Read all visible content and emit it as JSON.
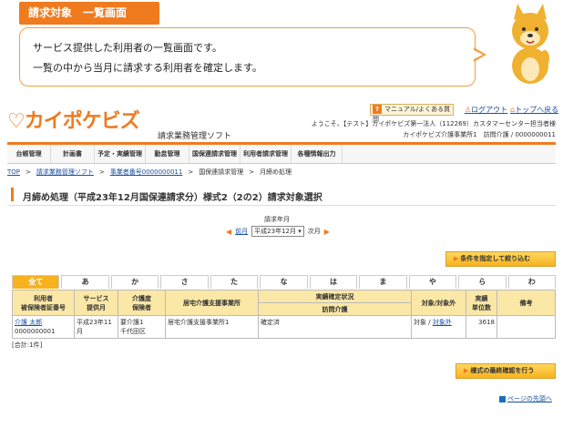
{
  "tutorial": {
    "title": "請求対象　一覧画面",
    "line1": "サービス提供した利用者の一覧画面です。",
    "line2": "一覧の中から当月に請求する利用者を確定します。"
  },
  "header": {
    "logo": "カイポケビズ",
    "subtitle": "請求業務管理ソフト",
    "help": "マニュアル/よくある質問",
    "logout": "ログアウト",
    "top": "トップへ戻る",
    "welcome1": "ようこそ、【テスト】カイポケビズ第一法人（112269）カスタマーセンター担当者様",
    "welcome2": "カイポケビズ介護事業所1　訪問介護 / 0000000011"
  },
  "menu": [
    "台帳管理",
    "計画書",
    "予定・実績管理",
    "勤怠管理",
    "国保連請求管理",
    "利用者請求管理",
    "各種情報出力"
  ],
  "breadcrumb": {
    "top": "TOP",
    "soft": "請求業務管理ソフト",
    "office": "事業者番号0000000011",
    "kokuho": "国保連請求管理",
    "current": "月締め処理"
  },
  "page_title": "月締め処理（平成23年12月国保連請求分）様式2（2の2）請求対象選択",
  "period": {
    "label": "請求年月",
    "prev": "前月",
    "selected": "平成23年12月",
    "next": "次月"
  },
  "buttons": {
    "filter": "条件を指定して絞り込む",
    "confirm": "様式の最終確認を行う"
  },
  "tabs": [
    "全て",
    "あ",
    "か",
    "さ",
    "た",
    "な",
    "は",
    "ま",
    "や",
    "ら",
    "わ"
  ],
  "table": {
    "headers": {
      "user": "利用者",
      "user2": "被保険者証番号",
      "service": "サービス",
      "service2": "提供月",
      "care": "介護度",
      "care2": "保険者",
      "office": "居宅介護支援事業所",
      "status": "実績確定状況",
      "status_sub": "訪問介護",
      "target": "対象/対象外",
      "units": "実績",
      "units2": "単位数",
      "note": "備考"
    },
    "rows": [
      {
        "name": "介護 太郎",
        "number": "0000000001",
        "month": "平成23年11月",
        "care": "要介護1",
        "insurer": "千代田区",
        "office": "居宅介護支援事業所1",
        "status": "確定済",
        "target": "対象",
        "target_sep": "/",
        "excluded": "対象外",
        "units": "3618",
        "note": ""
      }
    ]
  },
  "total": "[合計:1件]",
  "page_top": "ページの先頭へ",
  "colors": {
    "accent": "#f07a1e",
    "header_bg": "#fbe7a6",
    "link": "#1a4fa0"
  }
}
